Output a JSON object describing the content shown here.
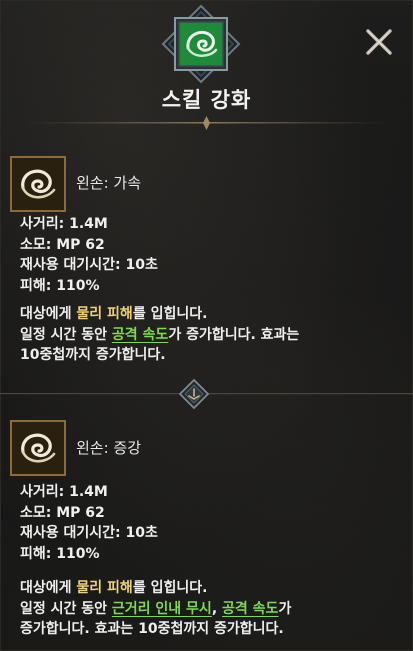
{
  "header": {
    "title": "스킬 강화",
    "emblem_icon": "green-swirl-skill-icon",
    "close_icon": "close-x-icon"
  },
  "skills": [
    {
      "icon": "gold-swirl-skill-icon",
      "name": "왼손: 가속",
      "stats": {
        "range": "사거리: 1.4M",
        "cost": "소모: MP 62",
        "cooldown": "재사용 대기시간: 10초",
        "damage": "피해: 110%"
      },
      "desc": {
        "l1_pre": "대상에게 ",
        "l1_hl": "물리 피해",
        "l1_post": "를 입힙니다.",
        "l2_pre": "일정 시간 동안 ",
        "l2_link": "공격 속도",
        "l2_post": "가 증가합니다. 효과는",
        "l3": "10중첩까지 증가합니다."
      }
    },
    {
      "icon": "gold-swirl-skill-icon",
      "name": "왼손: 증강",
      "stats": {
        "range": "사거리: 1.4M",
        "cost": "소모: MP 62",
        "cooldown": "재사용 대기시간: 10초",
        "damage": "피해: 110%"
      },
      "desc": {
        "l1_pre": "대상에게 ",
        "l1_hl": "물리 피해",
        "l1_post": "를 입힙니다.",
        "l2_pre": "일정 시간 동안 ",
        "l2_link1": "근거리 인내 무시",
        "l2_sep": ", ",
        "l2_link2": "공격 속도",
        "l2_post": "가",
        "l3": "증가합니다. 효과는 10중첩까지 증가합니다."
      }
    }
  ],
  "colors": {
    "background": "#141414",
    "highlight_yellow": "#f0d07a",
    "highlight_green": "#7fd957",
    "gold_frame": "#8c6a3a",
    "emblem_green": "#1e8a3a"
  }
}
